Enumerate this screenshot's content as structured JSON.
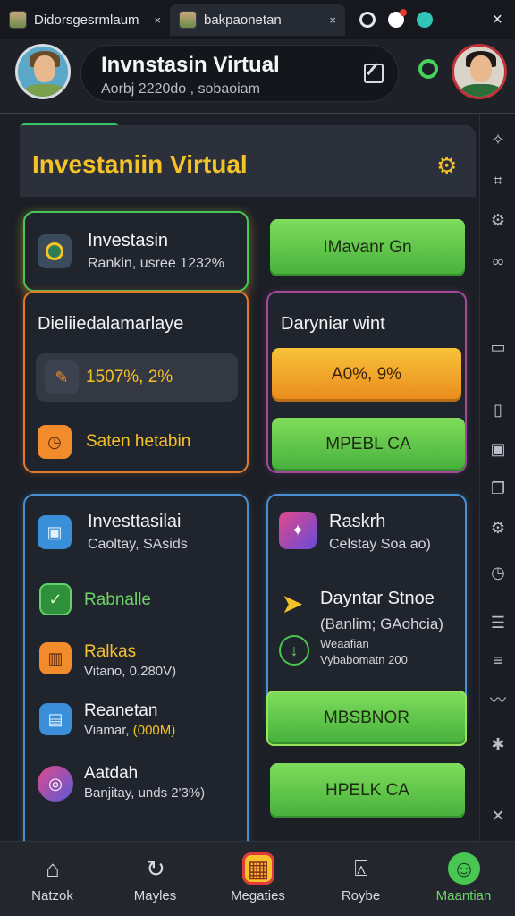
{
  "tabs": [
    {
      "title": "Didorsgesrmlaum",
      "close": "×"
    },
    {
      "title": "bakpaonetan",
      "close": "×"
    }
  ],
  "window": {
    "close": "×"
  },
  "header": {
    "title": "Invnstasin Virtual",
    "subtitle": "Aorbj 2220do , sobaoiam"
  },
  "main": {
    "title": "Investaniin Virtual"
  },
  "card_invest": {
    "title": "Investasin",
    "sub": "Rankin, usree 1232%"
  },
  "button_1": "IMavanr Gn",
  "card_diel": {
    "title": "Dieliiedalamarlaye",
    "stat": "1507%, 2%",
    "action": "Saten hetabin"
  },
  "card_dary": {
    "title": "Daryniar wint",
    "stat_button": "A0%, 9%",
    "button": "MPEBL CA"
  },
  "card_list": {
    "header_title": "Investtasilai",
    "header_sub": "Caoltay, SAsids",
    "items": [
      {
        "title": "Rabnalle"
      },
      {
        "title": "Ralkas",
        "sub": "Vitano, 0.280V)"
      },
      {
        "title": "Reanetan",
        "sub_prefix": "Viamar, ",
        "sub_highlight": "(000M)"
      },
      {
        "title": "Aatdah",
        "sub": "Banjitay, unds 2'3%)"
      }
    ]
  },
  "card_right": {
    "header_title": "Raskrh",
    "header_sub": "Celstay Soa ao)",
    "item_title": "Dayntar Stnoe",
    "item_sub": "(Banlim; GAohcia)",
    "small_title": "Weaafian",
    "small_sub": "Vybabomatn 200",
    "button_1": "MBSBNOR",
    "button_2": "HPELK CA"
  },
  "nav": [
    {
      "label": "Natzok",
      "icon": "home-icon"
    },
    {
      "label": "Mayles",
      "icon": "refresh-icon"
    },
    {
      "label": "Megaties",
      "icon": "grid-icon"
    },
    {
      "label": "Roybe",
      "icon": "badge-icon"
    },
    {
      "label": "Maantian",
      "icon": "user-icon"
    }
  ],
  "colors": {
    "accent_yellow": "#f5c22a",
    "accent_green": "#49c653",
    "accent_orange": "#e07a2c",
    "accent_purple": "#a2499a",
    "accent_blue": "#4a8fd2",
    "background": "#1c1f26"
  }
}
